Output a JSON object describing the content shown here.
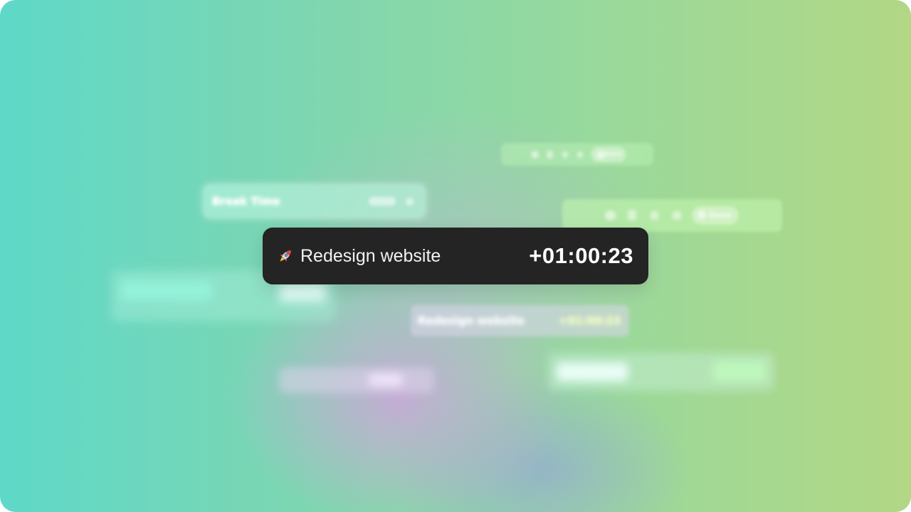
{
  "active_timer": {
    "task_icon": "rocket-icon",
    "task_name": "Redesign website",
    "elapsed": "+01:00:23"
  },
  "background_cards": [
    {
      "label": "Break Time",
      "badge": ""
    },
    {
      "label": "",
      "badge": "Done"
    },
    {
      "label": "",
      "badge": "Done"
    },
    {
      "label": "Redesign website",
      "badge": "+01:00:23"
    }
  ],
  "colors": {
    "card_bg": "#242424",
    "card_text": "#f2f2f2",
    "gradient_left": "#5ed8c8",
    "gradient_right": "#b2d785",
    "gradient_center": "#c8aad7"
  }
}
